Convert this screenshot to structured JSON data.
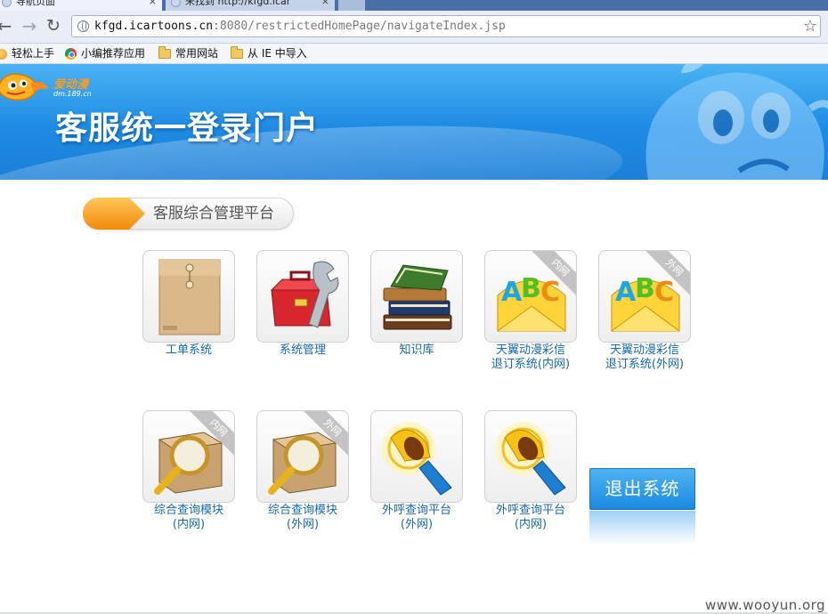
{
  "browser": {
    "tabs": [
      {
        "title": "导航页面",
        "active": true
      },
      {
        "title": "未找到 http://kfgd.icar",
        "active": false
      }
    ],
    "tab_close_glyph": "×",
    "url_host": "kfgd.icartoons.cn",
    "url_rest": ":8080/restrictedHomePage/navigateIndex.jsp",
    "bookmarks": [
      "轻松上手",
      "小编推荐应用",
      "常用网站",
      "从 IE 中导入"
    ]
  },
  "banner": {
    "logo_text": "爱动漫",
    "logo_sub": "dm.189.cn",
    "title": "客服统一登录门户"
  },
  "section": {
    "title": "客服综合管理平台"
  },
  "tiles": [
    {
      "label": "工单系统",
      "icon": "document-envelope-icon"
    },
    {
      "label": "系统管理",
      "icon": "toolbox-wrench-icon"
    },
    {
      "label": "知识库",
      "icon": "book-stack-icon"
    },
    {
      "label": "天翼动漫彩信\n退订系统(内网)",
      "icon": "abc-envelope-icon",
      "ribbon": "内网"
    },
    {
      "label": "天翼动漫彩信\n退订系统(外网)",
      "icon": "abc-envelope-icon",
      "ribbon": "外网"
    },
    {
      "label": "综合查询模块\n(内网)",
      "icon": "box-magnifier-icon",
      "ribbon": "内网"
    },
    {
      "label": "综合查询模块\n(外网)",
      "icon": "box-magnifier-icon",
      "ribbon": "外网"
    },
    {
      "label": "外呼查询平台\n(外网)",
      "icon": "megaphone-icon"
    },
    {
      "label": "外呼查询平台\n(内网)",
      "icon": "megaphone-icon"
    }
  ],
  "exit_button": {
    "label": "退出系统"
  },
  "watermark": "www.wooyun.org",
  "colors": {
    "banner_blue": "#1e8be3",
    "link_blue": "#1669a8",
    "accent_orange": "#f5a623"
  }
}
